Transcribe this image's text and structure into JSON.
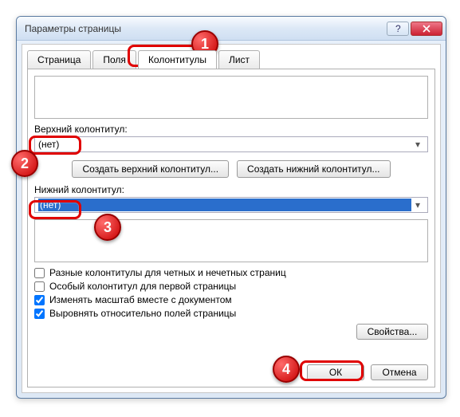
{
  "window": {
    "title": "Параметры страницы"
  },
  "tabs": {
    "page": "Страница",
    "margins": "Поля",
    "headers": "Колонтитулы",
    "sheet": "Лист"
  },
  "header_section": {
    "label": "Верхний колонтитул:",
    "value": "(нет)"
  },
  "footer_section": {
    "label": "Нижний колонтитул:",
    "value": "(нет)"
  },
  "buttons": {
    "create_header": "Создать верхний колонтитул...",
    "create_footer": "Создать нижний колонтитул...",
    "properties": "Свойства...",
    "ok": "ОК",
    "cancel": "Отмена"
  },
  "checks": {
    "diff_odd_even": "Разные колонтитулы для четных и нечетных страниц",
    "diff_first": "Особый колонтитул для первой страницы",
    "scale_with_doc": "Изменять масштаб вместе с документом",
    "align_margins": "Выровнять относительно полей страницы"
  },
  "callouts": {
    "1": "1",
    "2": "2",
    "3": "3",
    "4": "4"
  }
}
